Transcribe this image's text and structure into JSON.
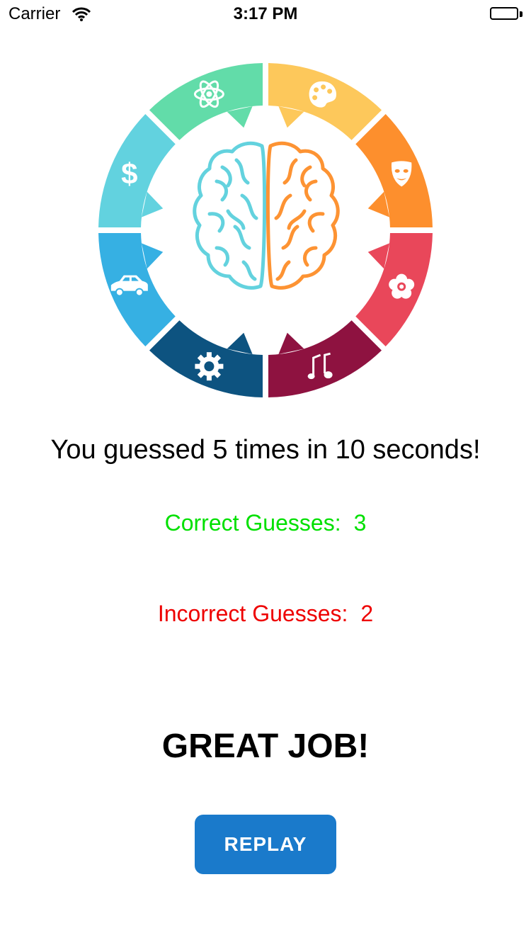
{
  "status_bar": {
    "carrier": "Carrier",
    "time": "3:17 PM",
    "icons": [
      "wifi-icon",
      "battery-icon"
    ]
  },
  "logo": {
    "segments": [
      {
        "icon": "atom-icon",
        "color": "#62dca9"
      },
      {
        "icon": "palette-icon",
        "color": "#fdc85b"
      },
      {
        "icon": "mask-icon",
        "color": "#fd8f2d"
      },
      {
        "icon": "flower-icon",
        "color": "#e9475a"
      },
      {
        "icon": "music-notes-icon",
        "color": "#8e1240"
      },
      {
        "icon": "gear-icon",
        "color": "#0d5380"
      },
      {
        "icon": "car-icon",
        "color": "#36b0e3"
      },
      {
        "icon": "dollar-icon",
        "color": "#62d2df"
      }
    ],
    "brain": {
      "left_color": "#63d2de",
      "right_color": "#fd9333"
    }
  },
  "results": {
    "summary": "You guessed 5 times in 10 seconds!",
    "correct_label": "Correct Guesses:",
    "correct_value": "3",
    "incorrect_label": "Incorrect Guesses:",
    "incorrect_value": "2",
    "verdict": "GREAT JOB!"
  },
  "replay_button": {
    "label": "REPLAY",
    "color": "#1a7acb"
  }
}
